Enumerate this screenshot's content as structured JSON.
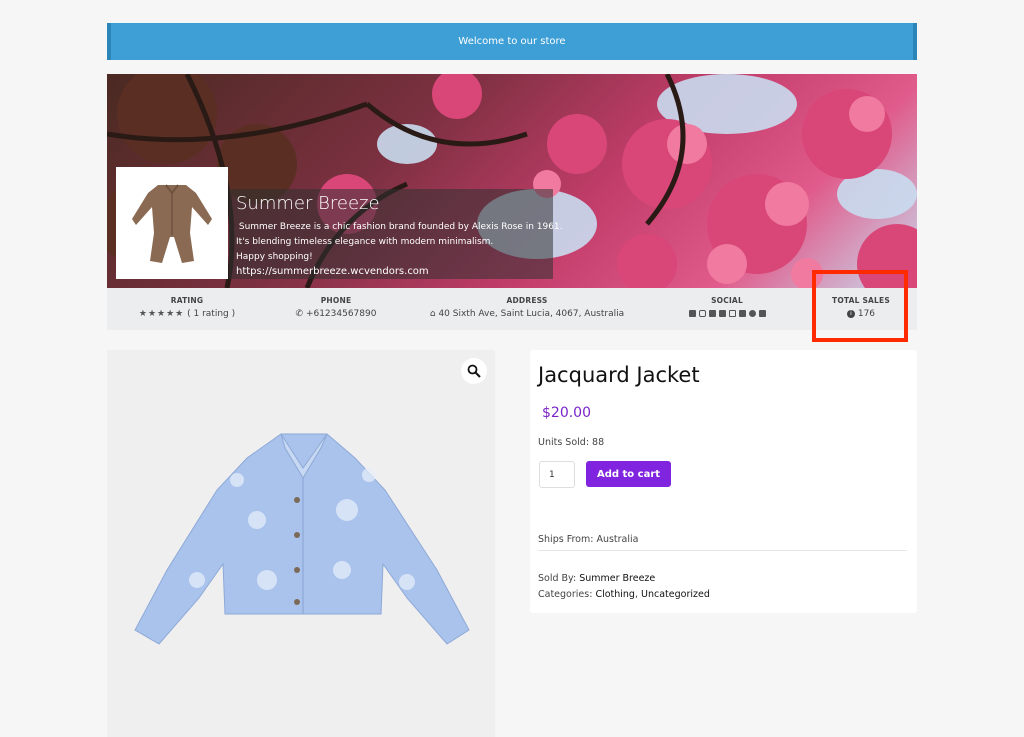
{
  "notice": {
    "text": "Welcome to our store"
  },
  "store": {
    "name": "Summer Breeze",
    "description_lines": [
      " Summer Breeze is a chic fashion brand founded by Alexis Rose in 1961.",
      "It's blending timeless elegance with modern minimalism.",
      "Happy shopping!"
    ],
    "url": "https://summerbreeze.wcvendors.com"
  },
  "infobar": {
    "rating": {
      "label": "RATING",
      "stars": 5,
      "value": "( 1 rating )"
    },
    "phone": {
      "label": "PHONE",
      "value": "+61234567890",
      "icon": "phone-icon"
    },
    "address": {
      "label": "ADDRESS",
      "value": "40 Sixth Ave, Saint Lucia, 4067, Australia",
      "icon": "home-icon"
    },
    "social": {
      "label": "SOCIAL",
      "icons": [
        "twitter-icon",
        "instagram-icon",
        "facebook-icon",
        "linkedin-icon",
        "youtube-icon",
        "pinterest-icon",
        "snapchat-icon",
        "telegram-icon"
      ]
    },
    "total_sales": {
      "label": "TOTAL SALES",
      "value": "176",
      "icon": "info-icon"
    }
  },
  "product": {
    "title": "Jacquard Jacket",
    "price": "$20.00",
    "units_sold": "Units Sold: 88",
    "quantity": "1",
    "add_to_cart": "Add to cart",
    "ships_from": "Ships From: Australia",
    "sold_by_label": "Sold By: ",
    "sold_by": "Summer Breeze",
    "categories_label": "Categories: ",
    "categories": [
      "Clothing",
      "Uncategorized"
    ],
    "category_separator": ", "
  },
  "colors": {
    "notice_bg": "#3d9fd6",
    "accent_purple": "#8124e0",
    "price": "#7a25c9",
    "highlight": "#ff2a00"
  }
}
